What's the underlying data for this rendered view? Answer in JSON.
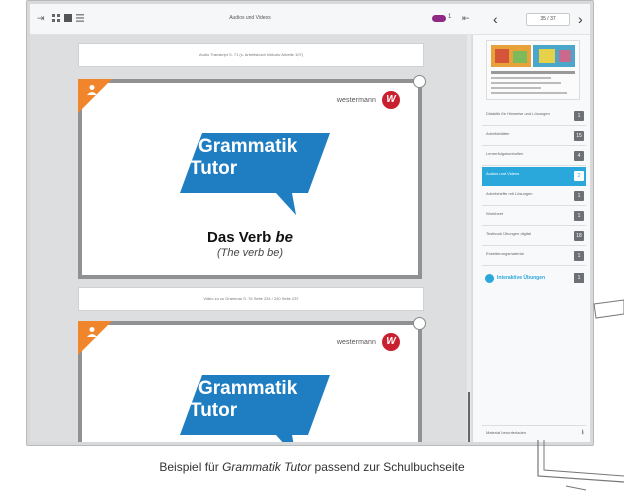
{
  "topbar": {
    "title": "Audios und Videos",
    "counter": "1",
    "page_indicator": "35 / 37",
    "prev_symbol": "‹",
    "next_symbol": "›"
  },
  "main": {
    "top_strip": "Audio Transkript S. 71 (s. Arbeitsbuch Inklusiv Arbeite 107)",
    "mid_strip": "Video zu zu Grammar S. 76 Seite 234 / 240 Seite 237",
    "slides": [
      {
        "brand": "westermann",
        "brand_logo": "W",
        "gt_line1": "Grammatik",
        "gt_line2": "Tutor",
        "verb_title": "Das Verb be",
        "verb_sub": "(The verb be)"
      },
      {
        "brand": "westermann",
        "brand_logo": "W",
        "gt_line1": "Grammatik",
        "gt_line2": "Tutor"
      }
    ]
  },
  "sidebar": {
    "items": [
      {
        "label": "Didaktik für Hinweise und Lösungen",
        "badge": "1",
        "active": false
      },
      {
        "label": "Arbeitsblätter",
        "badge": "15",
        "active": false
      },
      {
        "label": "Lernerfolgskontrollen",
        "badge": "4",
        "active": false
      },
      {
        "label": "Audios und Videos",
        "badge": "2",
        "active": true
      },
      {
        "label": "Arbeitshefte mit Lösungen",
        "badge": "1",
        "active": false
      },
      {
        "label": "Workheet",
        "badge": "1",
        "active": false
      },
      {
        "label": "Testbook Übungen digital",
        "badge": "18",
        "active": false
      },
      {
        "label": "Erweiterungsmaterial",
        "badge": "1",
        "active": false
      }
    ],
    "interactive": {
      "label": "Interaktive Übungen",
      "badge": "1"
    },
    "footer": "Material herunterladen"
  },
  "caption": {
    "prefix": "Beispiel für ",
    "italic": "Grammatik Tutor",
    "suffix": " passend zur Schulbuchseite"
  },
  "colors": {
    "accent_blue": "#2aa8dc",
    "tutor_blue": "#1f7ec2",
    "corner_orange": "#f1852b",
    "brand_red": "#c8202f",
    "pill_purple": "#8e2a86"
  }
}
